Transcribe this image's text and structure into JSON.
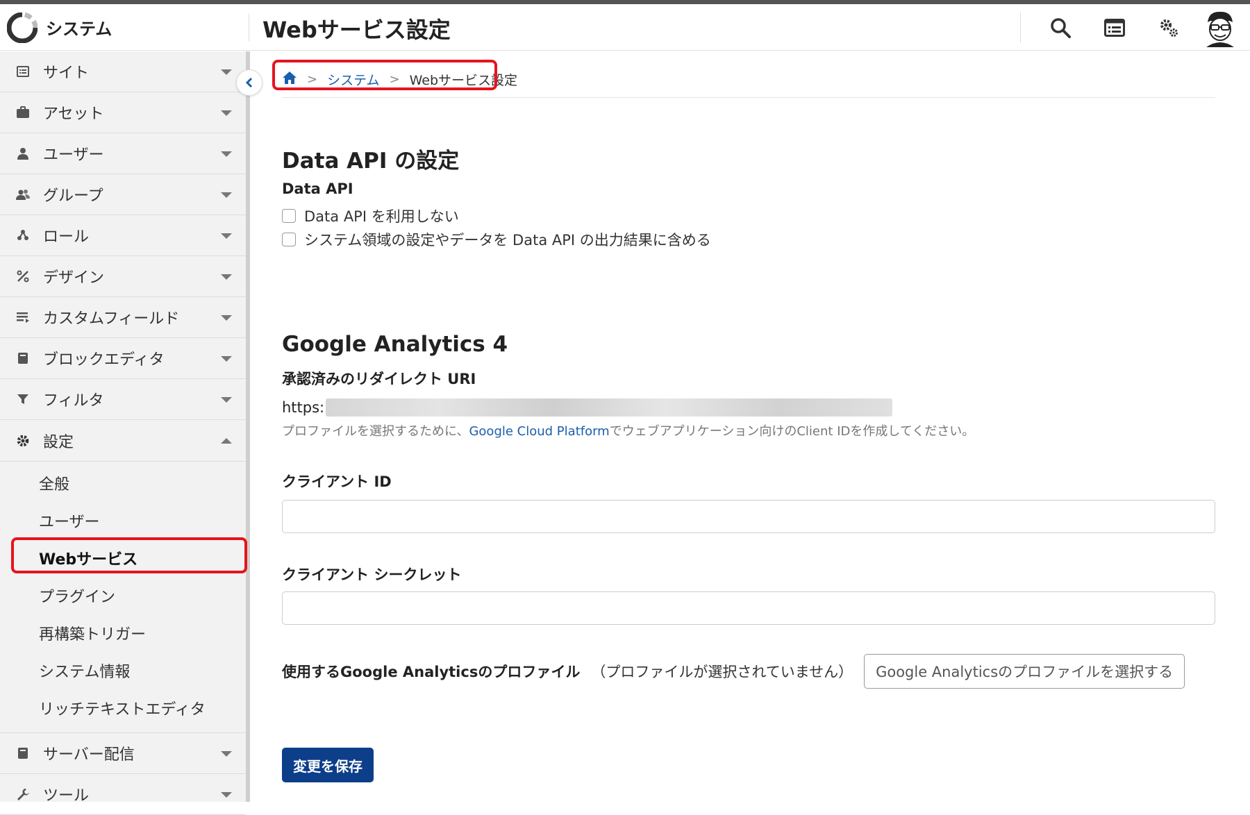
{
  "app": {
    "name": "システム"
  },
  "header": {
    "page_title": "Webサービス設定",
    "icons": [
      "search-icon",
      "list-icon",
      "gears-icon",
      "user-avatar"
    ]
  },
  "sidebar": {
    "items": [
      {
        "label": "サイト",
        "icon": "site-icon"
      },
      {
        "label": "アセット",
        "icon": "briefcase-icon"
      },
      {
        "label": "ユーザー",
        "icon": "user-icon"
      },
      {
        "label": "グループ",
        "icon": "group-icon"
      },
      {
        "label": "ロール",
        "icon": "role-icon"
      },
      {
        "label": "デザイン",
        "icon": "design-icon"
      },
      {
        "label": "カスタムフィールド",
        "icon": "custom-field-icon"
      },
      {
        "label": "ブロックエディタ",
        "icon": "block-editor-icon"
      },
      {
        "label": "フィルタ",
        "icon": "filter-icon"
      },
      {
        "label": "設定",
        "icon": "gear-icon"
      }
    ],
    "settings_sub": [
      {
        "label": "全般"
      },
      {
        "label": "ユーザー"
      },
      {
        "label": "Webサービス"
      },
      {
        "label": "プラグイン"
      },
      {
        "label": "再構築トリガー"
      },
      {
        "label": "システム情報"
      },
      {
        "label": "リッチテキストエディタ"
      }
    ],
    "bottom_items": [
      {
        "label": "サーバー配信",
        "icon": "server-icon"
      },
      {
        "label": "ツール",
        "icon": "wrench-icon"
      }
    ]
  },
  "breadcrumb": {
    "home_icon": "home-icon",
    "items": [
      "システム",
      "Webサービス設定"
    ]
  },
  "data_api": {
    "section_title": "Data API の設定",
    "field_label": "Data API",
    "options": [
      {
        "label": "Data API を利用しない",
        "checked": false
      },
      {
        "label": "システム領域の設定やデータを Data API の出力結果に含める",
        "checked": false
      }
    ]
  },
  "ga4": {
    "section_title": "Google Analytics 4",
    "redirect_label": "承認済みのリダイレクト URI",
    "redirect_prefix": "https:",
    "hint_before": "プロファイルを選択するために、",
    "hint_link": "Google Cloud Platform",
    "hint_after": "でウェブアプリケーション向けのClient IDを作成してください。",
    "client_id_label": "クライアント ID",
    "client_id_value": "",
    "client_secret_label": "クライアント シークレット",
    "client_secret_value": "",
    "profile_label": "使用するGoogle Analyticsのプロファイル",
    "profile_status": "（プロファイルが選択されていません）",
    "profile_button": "Google Analyticsのプロファイルを選択する"
  },
  "save_button": "変更を保存",
  "colors": {
    "accent": "#0d3e8a",
    "link": "#1a5fad",
    "highlight": "#e5141e"
  }
}
